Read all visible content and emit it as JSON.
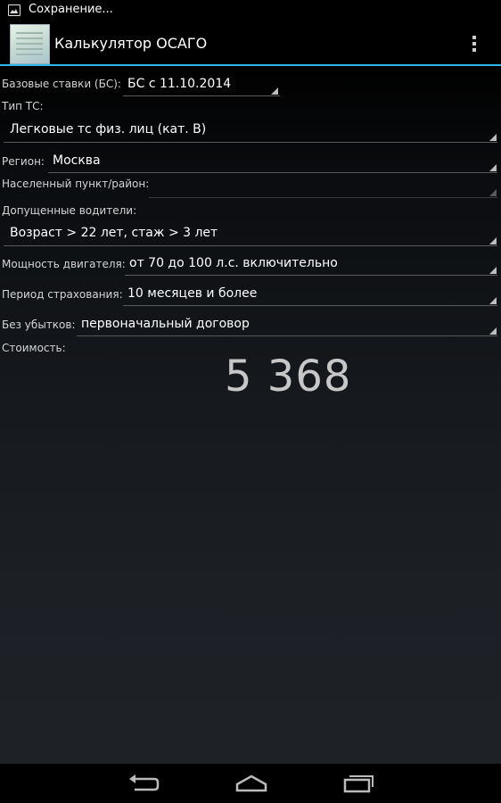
{
  "status_bar": {
    "notification_text": "Сохранение..."
  },
  "action_bar": {
    "title": "Калькулятор ОСАГО"
  },
  "form": {
    "base_rates": {
      "label": "Базовые ставки (БС):",
      "value": "БС с 11.10.2014"
    },
    "vehicle_type": {
      "label": "Тип ТС:",
      "value": "Легковые тс физ. лиц (кат. B)"
    },
    "region": {
      "label": "Регион:",
      "value": "Москва"
    },
    "locality": {
      "label": "Населенный пункт/район:",
      "value": ""
    },
    "drivers": {
      "label": "Допущенные водители:",
      "value": "Возраст > 22 лет, стаж > 3 лет"
    },
    "engine_power": {
      "label": "Мощность двигателя:",
      "value": "от 70 до 100 л.с. включительно"
    },
    "insurance_period": {
      "label": "Период страхования:",
      "value": "10 месяцев и более"
    },
    "no_claims": {
      "label": "Без убытков:",
      "value": "первоначальный договор"
    },
    "cost": {
      "label": "Стоимость:",
      "value": "5 368"
    }
  },
  "colors": {
    "accent": "#33b5e5",
    "background": "#000000",
    "text_primary": "#ffffff",
    "text_secondary": "#d4d4d4",
    "cost_text": "#c7c7c7"
  },
  "icons": [
    "image-icon",
    "app-icon",
    "overflow-menu-icon",
    "back-icon",
    "home-icon",
    "recent-apps-icon"
  ]
}
